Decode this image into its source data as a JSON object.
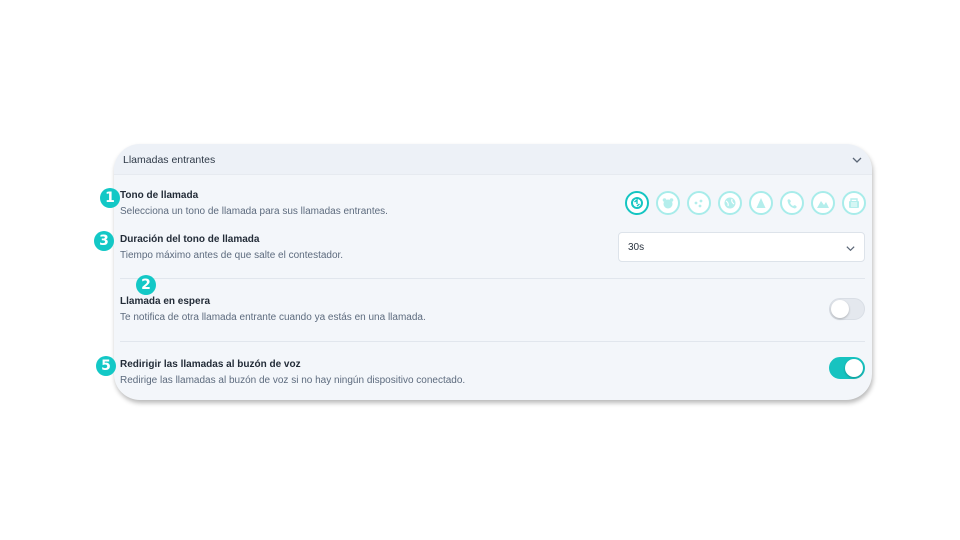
{
  "section": {
    "title": "Llamadas entrantes"
  },
  "ringtone": {
    "title": "Tono de llamada",
    "description": "Selecciona un tono de llamada para sus llamadas entrantes.",
    "selected_index": 0,
    "options": [
      "ringtone-default-icon",
      "ringtone-bear-icon",
      "ringtone-dots-icon",
      "ringtone-globe-icon",
      "ringtone-bell-icon",
      "ringtone-phone-icon",
      "ringtone-mountain-icon",
      "ringtone-basket-icon"
    ]
  },
  "duration": {
    "title": "Duración del tono de llamada",
    "description": "Tiempo máximo antes de que salte el contestador.",
    "value": "30s"
  },
  "call_waiting": {
    "title": "Llamada en espera",
    "description": "Te notifica de otra llamada entrante cuando ya estás en una llamada.",
    "enabled": false
  },
  "voicemail_redirect": {
    "title": "Redirigir las llamadas al buzón de voz",
    "description": "Redirige las llamadas al buzón de voz si no hay ningún dispositivo conectado.",
    "enabled": true
  },
  "badges": [
    "1",
    "3",
    "2",
    "5"
  ],
  "colors": {
    "accent": "#13c8c6",
    "panel_bg": "#f3f6fa",
    "header_bg": "#edf1f7"
  }
}
